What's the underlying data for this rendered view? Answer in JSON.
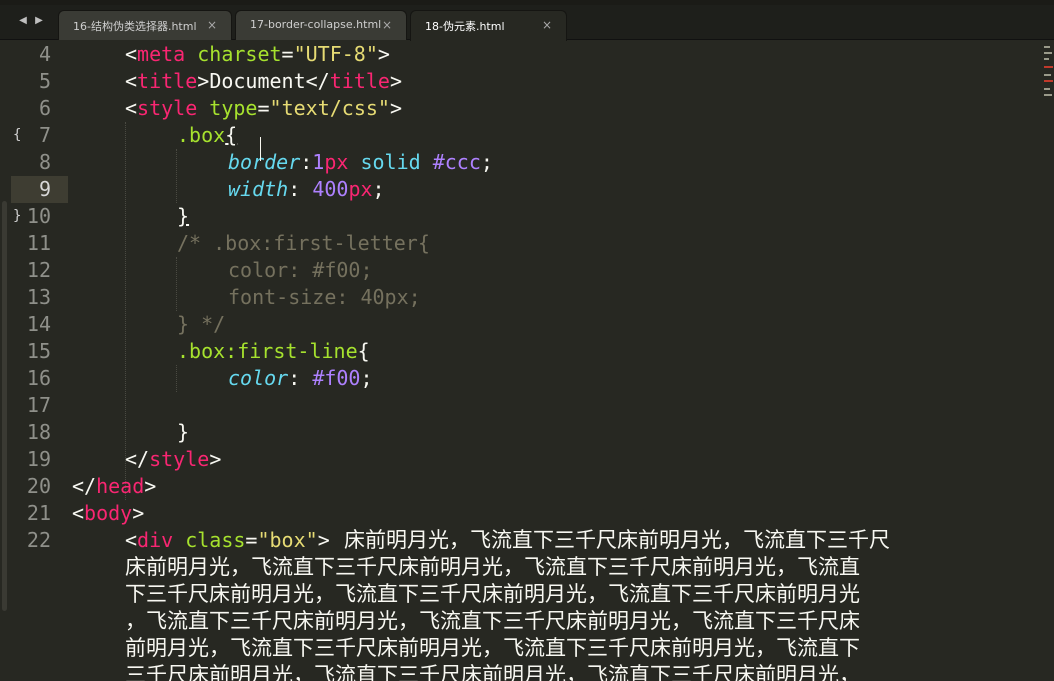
{
  "tabs": [
    {
      "label": "16-结构伪类选择器.html",
      "close": "×",
      "active": false
    },
    {
      "label": "17-border-collapse.html",
      "close": "×",
      "active": false
    },
    {
      "label": "18-伪元素.html",
      "close": "×",
      "active": true
    }
  ],
  "nav": {
    "back": "◀",
    "forward": "▶"
  },
  "gutter": {
    "lines": [
      "4",
      "5",
      "6",
      "7",
      "8",
      "9",
      "10",
      "11",
      "12",
      "13",
      "14",
      "15",
      "16",
      "17",
      "18",
      "19",
      "20",
      "21",
      "22"
    ],
    "current_line": "9",
    "fold_open": "{",
    "fold_close": "}"
  },
  "code": {
    "l4": {
      "lt": "<",
      "tag": "meta",
      "attr": " charset",
      "eq": "=",
      "val": "\"UTF-8\"",
      "gt": ">"
    },
    "l5": {
      "lt": "<",
      "tag": "title",
      "gt": ">",
      "text": "Document",
      "lt2": "</",
      "tag2": "title",
      "gt2": ">"
    },
    "l6": {
      "lt": "<",
      "tag": "style",
      "attr": " type",
      "eq": "=",
      "val": "\"text/css\"",
      "gt": ">"
    },
    "l7": {
      "sel": ".box",
      "brace": "{"
    },
    "l8": {
      "prop": "border",
      "colon": ":",
      "num": "1",
      "unit": "px",
      "kw1": " solid",
      "hex": " #ccc",
      "semi": ";"
    },
    "l9": {
      "prop": "width",
      "colon": ": ",
      "num": "400",
      "unit": "px",
      "semi": ";"
    },
    "l10": {
      "brace": "}"
    },
    "l11": {
      "comment": "/* .box:first-letter{"
    },
    "l12": {
      "comment": "color: #f00;"
    },
    "l13": {
      "comment": "font-size: 40px;"
    },
    "l14": {
      "comment": "} */"
    },
    "l15": {
      "sel": ".box:first-line",
      "brace": "{"
    },
    "l16": {
      "prop": "color",
      "colon": ": ",
      "hex": "#f00",
      "semi": ";"
    },
    "l18": {
      "brace": "}"
    },
    "l19": {
      "lt": "</",
      "tag": "style",
      "gt": ">"
    },
    "l20": {
      "lt": "</",
      "tag": "head",
      "gt": ">"
    },
    "l21": {
      "lt": "<",
      "tag": "body",
      "gt": ">"
    },
    "l22": {
      "lt": "<",
      "tag": "div",
      "attr": " class",
      "eq": "=",
      "val": "\"box\"",
      "gt": ">"
    }
  },
  "poem_lines": [
    "床前明月光，飞流直下三千尺床前明月光，飞流直下三千尺",
    "床前明月光，飞流直下三千尺床前明月光，飞流直下三千尺床前明月光，飞流直",
    "下三千尺床前明月光，飞流直下三千尺床前明月光，飞流直下三千尺床前明月光",
    "，飞流直下三千尺床前明月光，飞流直下三千尺床前明月光，飞流直下三千尺床",
    "前明月光，飞流直下三千尺床前明月光，飞流直下三千尺床前明月光，飞流直下",
    "三千尺床前明月光，飞流直下三千尺床前明月光，飞流直下三千尺床前明月光，"
  ]
}
